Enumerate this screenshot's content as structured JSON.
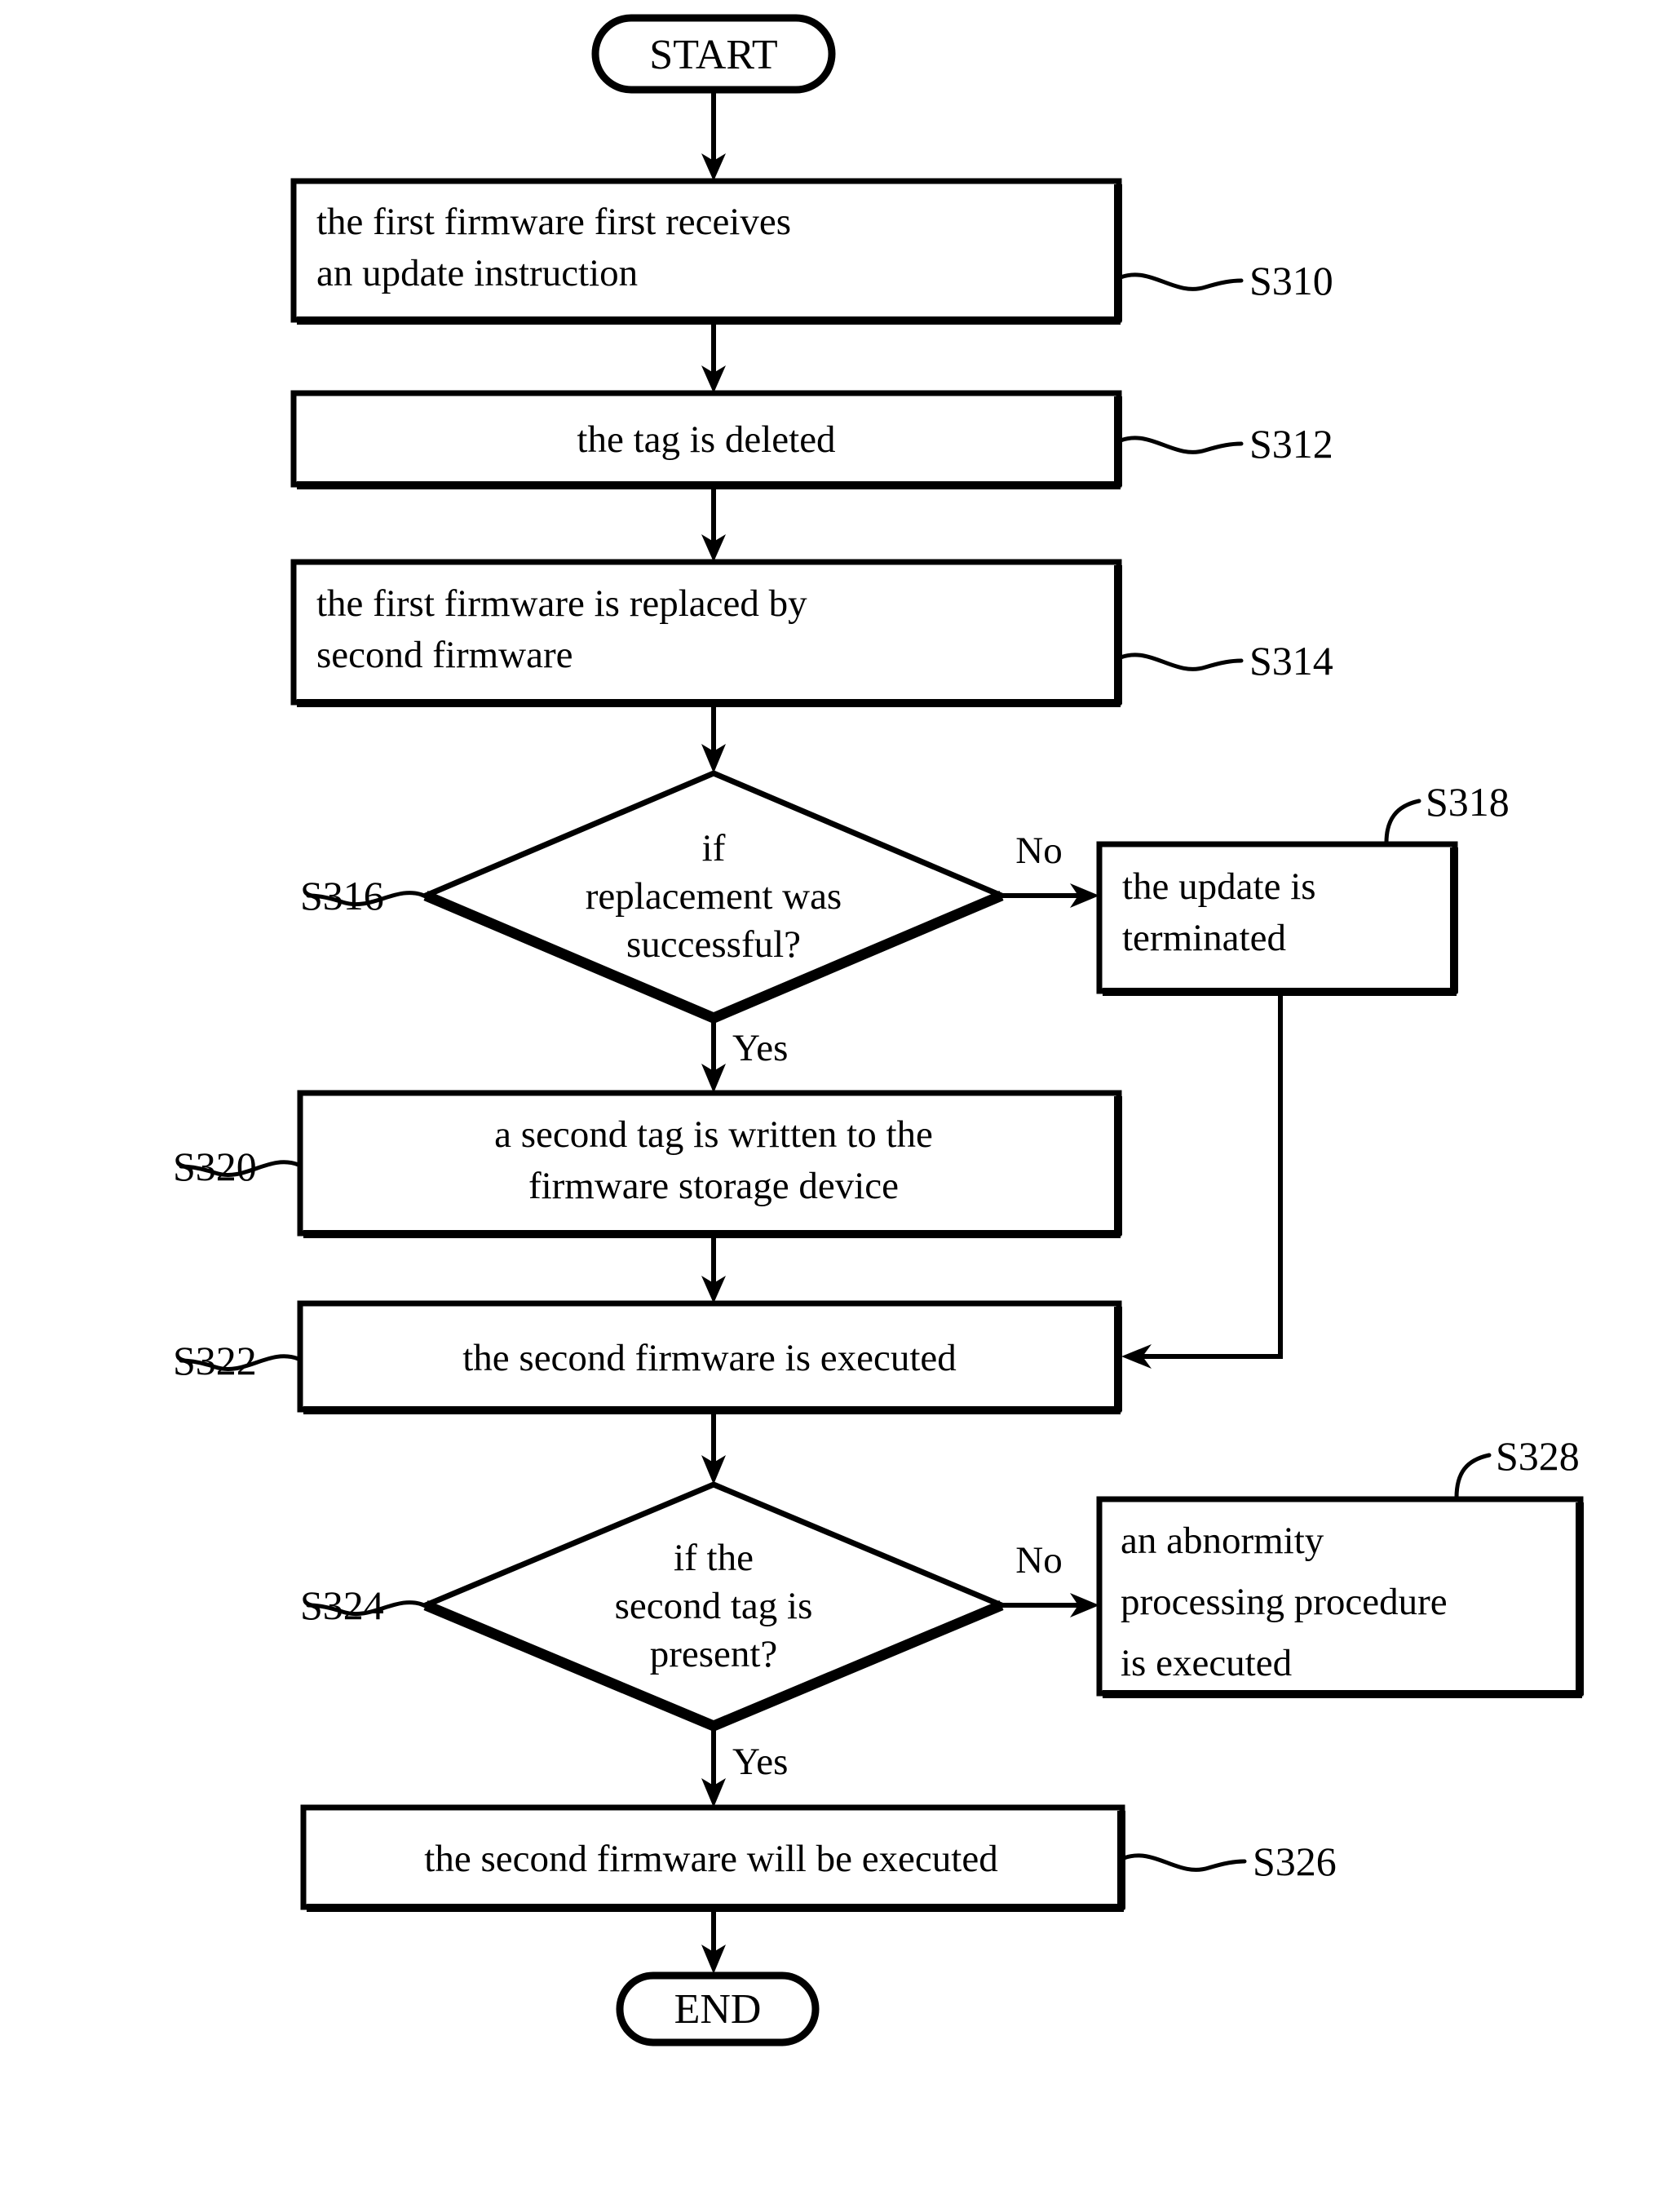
{
  "diagram": {
    "title": "Firmware update flowchart",
    "type": "flowchart",
    "colors": {
      "stroke": "#000000",
      "fill": "#ffffff",
      "text": "#000000"
    },
    "terminals": {
      "start": "START",
      "end": "END"
    },
    "nodes": [
      {
        "ref": "S310",
        "kind": "process",
        "align": "left",
        "lines": [
          "the first firmware first receives",
          "an update instruction"
        ]
      },
      {
        "ref": "S312",
        "kind": "process",
        "align": "center",
        "lines": [
          "the tag is deleted"
        ]
      },
      {
        "ref": "S314",
        "kind": "process",
        "align": "left",
        "lines": [
          "the first firmware is replaced by",
          "second firmware"
        ]
      },
      {
        "ref": "S316",
        "kind": "decision",
        "align": "center",
        "lines": [
          "if",
          "replacement was",
          "successful?"
        ]
      },
      {
        "ref": "S318",
        "kind": "process",
        "align": "left",
        "lines": [
          "the update is",
          "terminated"
        ]
      },
      {
        "ref": "S320",
        "kind": "process",
        "align": "center",
        "lines": [
          "a second tag is written to the",
          "firmware storage device"
        ]
      },
      {
        "ref": "S322",
        "kind": "process",
        "align": "center",
        "lines": [
          "the second firmware is executed"
        ]
      },
      {
        "ref": "S324",
        "kind": "decision",
        "align": "center",
        "lines": [
          "if the",
          "second tag is",
          "present?"
        ]
      },
      {
        "ref": "S328",
        "kind": "process",
        "align": "left",
        "lines": [
          "an abnormity",
          "processing procedure",
          "is executed"
        ]
      },
      {
        "ref": "S326",
        "kind": "process",
        "align": "center",
        "lines": [
          "the second firmware will be executed"
        ]
      }
    ],
    "branch_labels": {
      "s316_no": "No",
      "s316_yes": "Yes",
      "s324_no": "No",
      "s324_yes": "Yes"
    },
    "reference_labels": [
      "S310",
      "S312",
      "S314",
      "S316",
      "S318",
      "S320",
      "S322",
      "S324",
      "S326",
      "S328"
    ]
  }
}
